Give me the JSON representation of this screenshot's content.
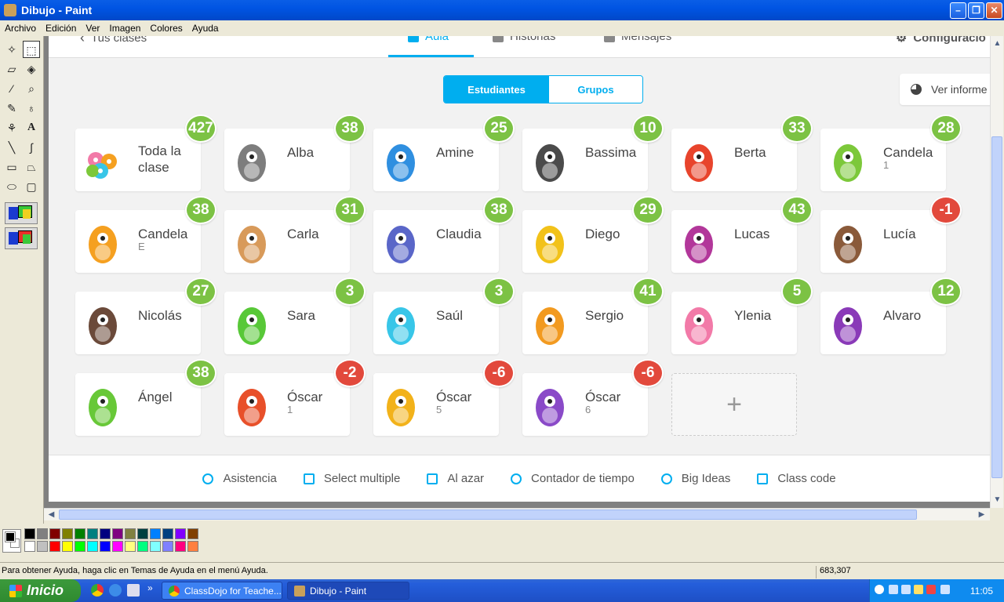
{
  "window": {
    "title": "Dibujo - Paint",
    "minimize": "–",
    "maximize": "❐",
    "close": "✕"
  },
  "menu": [
    "Archivo",
    "Edición",
    "Ver",
    "Imagen",
    "Colores",
    "Ayuda"
  ],
  "app": {
    "nav": {
      "back": "Tus clases",
      "tabs": [
        {
          "label": "Aula",
          "active": true
        },
        {
          "label": "Historias",
          "active": false
        },
        {
          "label": "Mensajes",
          "active": false
        }
      ],
      "settings": "Configuració"
    },
    "view_toggle": {
      "students": "Estudiantes",
      "groups": "Grupos",
      "active": "Estudiantes"
    },
    "report_button": "Ver informe",
    "whole_class": {
      "line1": "Toda la",
      "line2": "clase",
      "points": "427"
    },
    "students": [
      {
        "name": "Alba",
        "sub": "",
        "points": "38",
        "color": "#7d7d7d"
      },
      {
        "name": "Amine",
        "sub": "",
        "points": "25",
        "color": "#2f8fe0"
      },
      {
        "name": "Bassima",
        "sub": "",
        "points": "10",
        "color": "#4b4b4b"
      },
      {
        "name": "Berta",
        "sub": "",
        "points": "33",
        "color": "#e8442c"
      },
      {
        "name": "Candela",
        "sub": "1",
        "points": "28",
        "color": "#7cc83a"
      },
      {
        "name": "Candela",
        "sub": "E",
        "points": "38",
        "color": "#f5a020"
      },
      {
        "name": "Carla",
        "sub": "",
        "points": "31",
        "color": "#d89a5a"
      },
      {
        "name": "Claudia",
        "sub": "",
        "points": "38",
        "color": "#5a66c8"
      },
      {
        "name": "Diego",
        "sub": "",
        "points": "29",
        "color": "#f2c21a"
      },
      {
        "name": "Lucas",
        "sub": "",
        "points": "43",
        "color": "#b2379a"
      },
      {
        "name": "Lucía",
        "sub": "",
        "points": "-1",
        "color": "#8a5a3a"
      },
      {
        "name": "Nicolás",
        "sub": "",
        "points": "27",
        "color": "#6b4a3a"
      },
      {
        "name": "Sara",
        "sub": "",
        "points": "3",
        "color": "#58c838"
      },
      {
        "name": "Saúl",
        "sub": "",
        "points": "3",
        "color": "#38c6e8"
      },
      {
        "name": "Sergio",
        "sub": "",
        "points": "41",
        "color": "#f29a20"
      },
      {
        "name": "Ylenia",
        "sub": "",
        "points": "5",
        "color": "#f27aa8"
      },
      {
        "name": "Alvaro",
        "sub": "",
        "points": "12",
        "color": "#8a3ab8"
      },
      {
        "name": "Ángel",
        "sub": "",
        "points": "38",
        "color": "#68c838"
      },
      {
        "name": "Óscar",
        "sub": "1",
        "points": "-2",
        "color": "#e8502a"
      },
      {
        "name": "Óscar",
        "sub": "5",
        "points": "-6",
        "color": "#f2b21a"
      },
      {
        "name": "Óscar",
        "sub": "6",
        "points": "-6",
        "color": "#8a4ac8"
      }
    ],
    "add_student": "+",
    "toolbar": [
      {
        "label": "Asistencia",
        "icon": "clock-icon"
      },
      {
        "label": "Select multiple",
        "icon": "checkbox-icon"
      },
      {
        "label": "Al azar",
        "icon": "shuffle-icon"
      },
      {
        "label": "Contador de tiempo",
        "icon": "stopwatch-icon"
      },
      {
        "label": "Big Ideas",
        "icon": "lightbulb-icon"
      },
      {
        "label": "Class code",
        "icon": "camera-icon"
      }
    ]
  },
  "palette": [
    "#000000",
    "#808080",
    "#800000",
    "#808000",
    "#008000",
    "#008080",
    "#000080",
    "#800080",
    "#808040",
    "#004040",
    "#0080ff",
    "#004080",
    "#8000ff",
    "#804000",
    "#ffffff",
    "#c0c0c0",
    "#ff0000",
    "#ffff00",
    "#00ff00",
    "#00ffff",
    "#0000ff",
    "#ff00ff",
    "#ffff80",
    "#00ff80",
    "#80ffff",
    "#8080ff",
    "#ff0080",
    "#ff8040"
  ],
  "status": {
    "help": "Para obtener Ayuda, haga clic en Temas de Ayuda en el menú Ayuda.",
    "coords": "683,307"
  },
  "taskbar": {
    "start": "Inicio",
    "chevron": "»",
    "tasks": [
      {
        "label": "ClassDojo for Teache...",
        "active": false
      },
      {
        "label": "Dibujo - Paint",
        "active": true
      }
    ],
    "clock": "11:05"
  },
  "accent": "#00aeef",
  "positive_badge": "#7cc244",
  "negative_badge": "#e2493c"
}
